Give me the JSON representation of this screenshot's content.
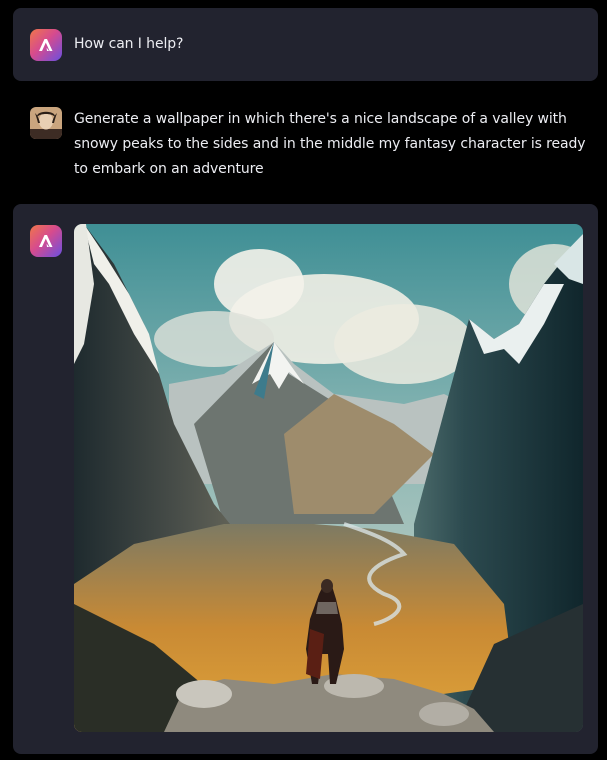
{
  "messages": {
    "greeting": {
      "author": "assistant",
      "text": "How can I help?"
    },
    "prompt": {
      "author": "user",
      "text": "Generate a wallpaper in which there's a nice landscape of a valley with snowy peaks to the sides and in the middle my fantasy character is ready to embark on an adventure"
    },
    "reply": {
      "author": "assistant",
      "image_subject": "generated-wallpaper-valley-landscape"
    }
  },
  "colors": {
    "page_background": "#000000",
    "card_background": "#22232f",
    "text": "#ecedf2",
    "logo_gradient_start": "#f0764a",
    "logo_gradient_mid": "#d64b8e",
    "logo_gradient_end": "#6a4fe0"
  },
  "icons": {
    "assistant_avatar": "assistant-logo-icon",
    "user_avatar": "user-avatar-icon"
  }
}
